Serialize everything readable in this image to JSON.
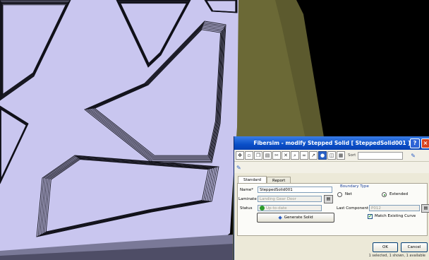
{
  "colors": {
    "surface": "#c9c6ef",
    "panel_line": "#101018",
    "frame": "#5c5a2e",
    "background": "#000000",
    "title_blue": "#0a4fc8"
  },
  "dialog": {
    "title": "Fibersim - modify Stepped Solid [ SteppedSolid001 ]",
    "help_label": "?",
    "close_label": "×",
    "sort_label": "Sort",
    "tabs": [
      {
        "label": "Standard",
        "active": true
      },
      {
        "label": "Report",
        "active": false
      }
    ],
    "name_label": "Name*",
    "name_value": "SteppedSolid001",
    "laminate_label": "Laminate",
    "laminate_value": "Landing Gear Door",
    "status_label": "Status",
    "status_value": "Up-to-date",
    "generate_button": "Generate Solid",
    "boundary_title": "Boundary Type",
    "boundary_options": [
      {
        "label": "Net",
        "selected": false
      },
      {
        "label": "Extended",
        "selected": true
      }
    ],
    "last_component_label": "Last Component",
    "last_component_value": "P012",
    "match_curve_label": "Match Existing Curve",
    "match_curve_checked": true,
    "ok_label": "OK",
    "cancel_label": "Cancel",
    "status_bar": "1 selected, 1 shown, 1 available"
  },
  "icons": [
    "move-icon",
    "new-icon",
    "copy-icon",
    "paste-icon",
    "cut-icon",
    "delete-icon",
    "find-icon",
    "binoculars-icon",
    "export-icon",
    "sphere-icon",
    "view-icon",
    "grid-icon",
    "pen-icon",
    "sort-icon"
  ]
}
